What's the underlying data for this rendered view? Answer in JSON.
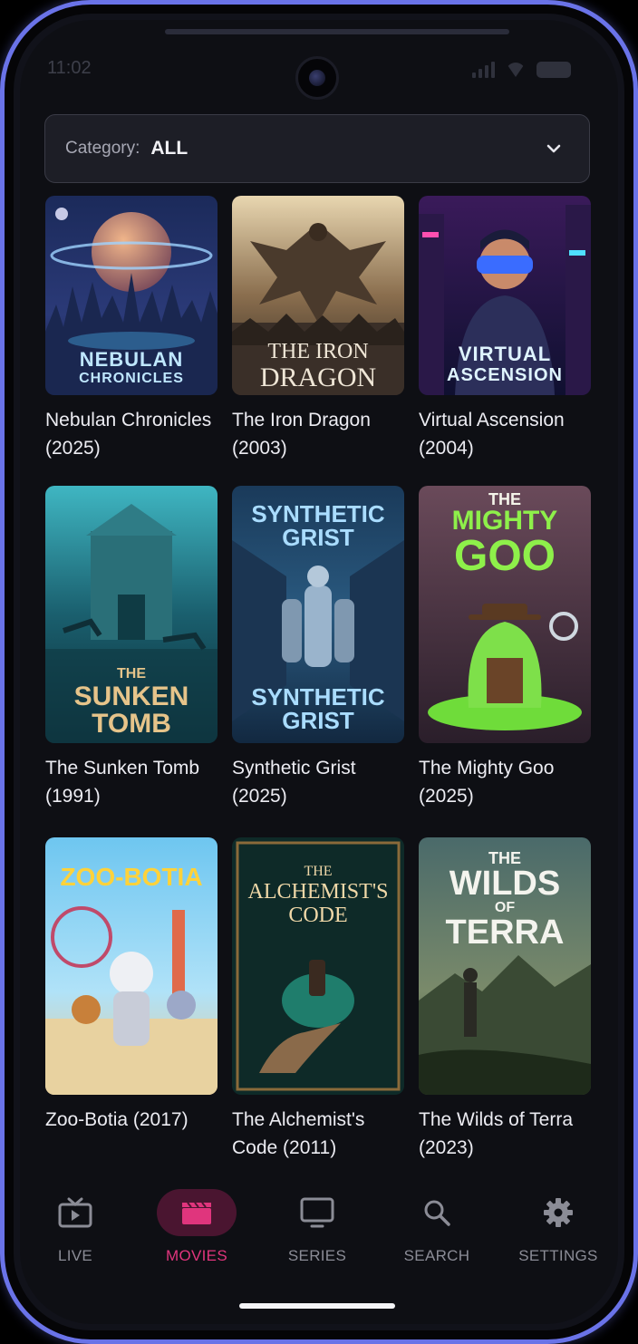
{
  "status_bar": {
    "time": "11:02"
  },
  "category": {
    "label": "Category:",
    "value": "ALL"
  },
  "movies": [
    {
      "title": "Nebulan Chronicles (2025)",
      "poster_text": [
        "NEBULAN",
        "CHRONICLES"
      ]
    },
    {
      "title": "The Iron Dragon (2003)",
      "poster_text": [
        "THE IRON",
        "DRAGON"
      ]
    },
    {
      "title": "Virtual Ascension (2004)",
      "poster_text": [
        "VIRTUAL",
        "ASCENSION"
      ]
    },
    {
      "title": "The Sunken Tomb (1991)",
      "poster_text": [
        "THE",
        "SUNKEN",
        "TOMB"
      ]
    },
    {
      "title": "Synthetic Grist (2025)",
      "poster_text": [
        "SYNTHETIC",
        "GRIST"
      ]
    },
    {
      "title": "The Mighty Goo (2025)",
      "poster_text": [
        "THE",
        "MIGHTY",
        "GOO"
      ]
    },
    {
      "title": "Zoo-Botia (2017)",
      "poster_text": [
        "ZOO-BOTIA"
      ]
    },
    {
      "title": "The Alchemist's Code (2011)",
      "poster_text": [
        "THE",
        "ALCHEMIST'S",
        "CODE"
      ]
    },
    {
      "title": "The Wilds of Terra (2023)",
      "poster_text": [
        "THE",
        "WILDS",
        "OF",
        "TERRA"
      ]
    }
  ],
  "nav": {
    "items": [
      {
        "label": "LIVE",
        "icon": "tv-icon"
      },
      {
        "label": "MOVIES",
        "icon": "clapperboard-icon",
        "active": true
      },
      {
        "label": "SERIES",
        "icon": "monitor-icon"
      },
      {
        "label": "SEARCH",
        "icon": "search-icon"
      },
      {
        "label": "SETTINGS",
        "icon": "gear-icon"
      }
    ]
  },
  "colors": {
    "accent": "#e0357d",
    "active_nav_bg": "#4a1530",
    "frame": "#6a73e8"
  }
}
